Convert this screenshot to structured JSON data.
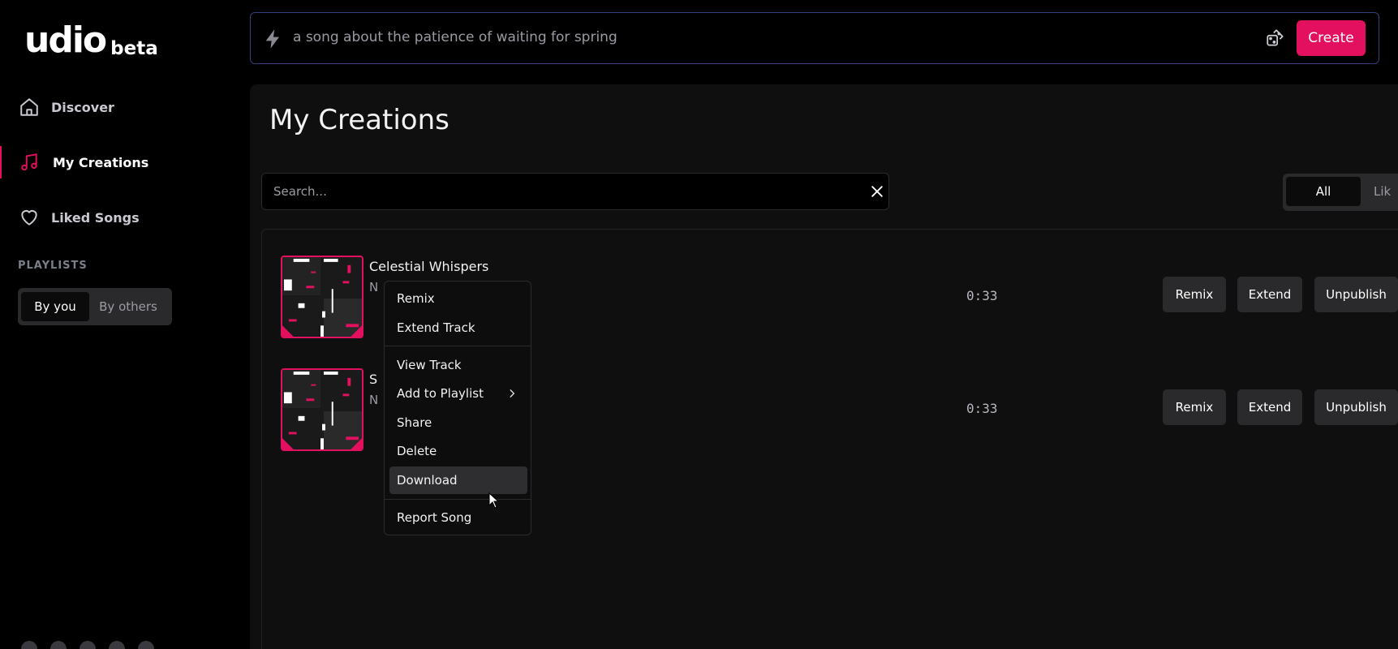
{
  "logo": {
    "main": "udio",
    "badge": "beta"
  },
  "sidebar": {
    "items": [
      {
        "label": "Discover",
        "icon": "home-icon"
      },
      {
        "label": "My Creations",
        "icon": "music-note-icon",
        "active": true
      },
      {
        "label": "Liked Songs",
        "icon": "heart-icon"
      }
    ],
    "playlists_heading": "PLAYLISTS",
    "playlist_toggle": {
      "active": "By you",
      "inactive": "By others"
    }
  },
  "prompt": {
    "text": "a song about the patience of waiting for spring",
    "create_label": "Create"
  },
  "main": {
    "title": "My Creations",
    "search_placeholder": "Search...",
    "filter_tabs": {
      "active": "All",
      "partial": "Lik"
    }
  },
  "songs": [
    {
      "title": "Celestial Whispers",
      "sub": "N",
      "duration": "0:33"
    },
    {
      "title": "S",
      "sub": "N",
      "duration": "0:33"
    }
  ],
  "actions": {
    "remix": "Remix",
    "extend": "Extend",
    "unpublish": "Unpublish"
  },
  "context_menu": {
    "remix": "Remix",
    "extend_track": "Extend Track",
    "view_track": "View Track",
    "add_to_playlist": "Add to Playlist",
    "share": "Share",
    "delete": "Delete",
    "download": "Download",
    "report_song": "Report Song"
  },
  "colors": {
    "accent": "#e3105f",
    "panel": "#0f0f0f",
    "button": "#2a2a2c"
  }
}
